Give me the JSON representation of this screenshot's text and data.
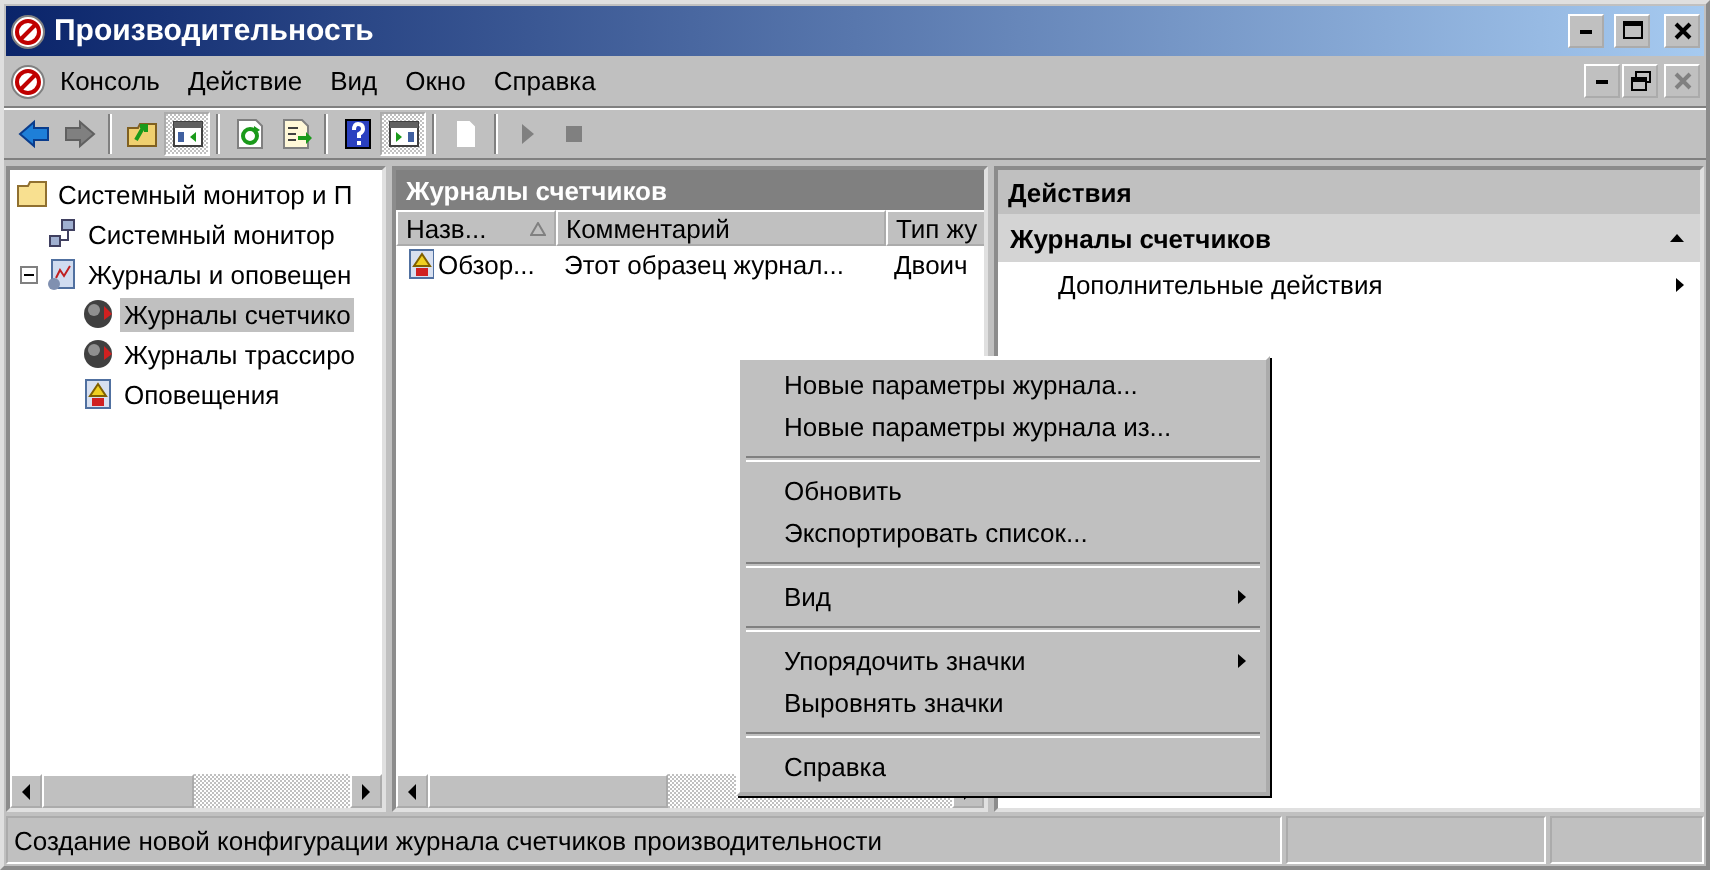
{
  "window": {
    "title": "Производительность"
  },
  "menu": [
    "Консоль",
    "Действие",
    "Вид",
    "Окно",
    "Справка"
  ],
  "toolbar": [
    {
      "kind": "back",
      "disabled": false,
      "pressed": false
    },
    {
      "kind": "forward",
      "disabled": true,
      "pressed": false
    },
    {
      "kind": "separator"
    },
    {
      "kind": "up",
      "pressed": false
    },
    {
      "kind": "tree-toggle",
      "pressed": true
    },
    {
      "kind": "separator"
    },
    {
      "kind": "refresh",
      "pressed": false
    },
    {
      "kind": "export",
      "pressed": false
    },
    {
      "kind": "separator"
    },
    {
      "kind": "help",
      "pressed": false
    },
    {
      "kind": "actions-toggle",
      "pressed": true
    },
    {
      "kind": "separator"
    },
    {
      "kind": "new",
      "pressed": false
    },
    {
      "kind": "separator"
    },
    {
      "kind": "start",
      "disabled": true,
      "pressed": false
    },
    {
      "kind": "stop",
      "disabled": true,
      "pressed": false
    }
  ],
  "tree": [
    {
      "label": "Системный монитор и П",
      "kind": "folder",
      "selected": false,
      "children": [
        {
          "label": "Системный монитор",
          "kind": "monitor",
          "selected": false
        },
        {
          "label": "Журналы и оповещен",
          "kind": "logs",
          "selected": false,
          "expanded": true,
          "children": [
            {
              "label": "Журналы счетчико",
              "kind": "counter",
              "selected": true
            },
            {
              "label": "Журналы трассиро",
              "kind": "counter",
              "selected": false
            },
            {
              "label": "Оповещения",
              "kind": "alert",
              "selected": false
            }
          ]
        }
      ]
    }
  ],
  "list": {
    "title": "Журналы счетчиков",
    "columns": [
      {
        "label": "Назв...",
        "sorted": true
      },
      {
        "label": "Комментарий",
        "sorted": false
      },
      {
        "label": "Тип жу",
        "sorted": false
      }
    ],
    "rows": [
      {
        "cells": [
          "Обзор...",
          "Этот образец журнал...",
          "Двоич"
        ],
        "selected": false
      }
    ]
  },
  "actions": {
    "title": "Действия",
    "sections": [
      {
        "title": "Журналы счетчиков",
        "expanded": true,
        "items": [
          {
            "label": "Дополнительные действия",
            "submenu": true
          }
        ]
      }
    ]
  },
  "context_menu": [
    {
      "kind": "item",
      "label": "Новые параметры журнала...",
      "submenu": false
    },
    {
      "kind": "item",
      "label": "Новые параметры журнала из...",
      "submenu": false
    },
    {
      "kind": "separator"
    },
    {
      "kind": "item",
      "label": "Обновить",
      "submenu": false
    },
    {
      "kind": "item",
      "label": "Экспортировать список...",
      "submenu": false
    },
    {
      "kind": "separator"
    },
    {
      "kind": "item",
      "label": "Вид",
      "submenu": true
    },
    {
      "kind": "separator"
    },
    {
      "kind": "item",
      "label": "Упорядочить значки",
      "submenu": true
    },
    {
      "kind": "item",
      "label": "Выровнять значки",
      "submenu": false
    },
    {
      "kind": "separator"
    },
    {
      "kind": "item",
      "label": "Справка",
      "submenu": false
    }
  ],
  "status_bar": {
    "text": "Создание новой конфигурации журнала счетчиков производительности"
  }
}
